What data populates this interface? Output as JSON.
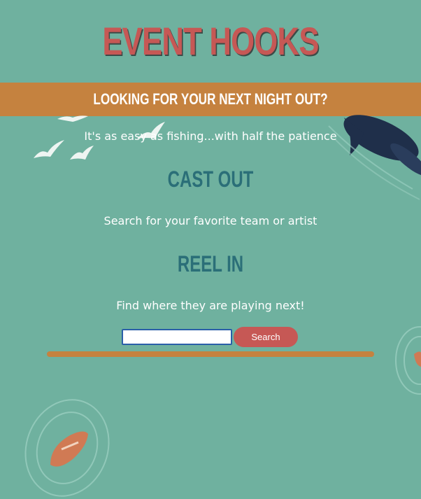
{
  "header": {
    "title": "EVENT HOOKS"
  },
  "banner": {
    "text": "LOOKING FOR YOUR NEXT NIGHT OUT?"
  },
  "intro": {
    "tagline": "It's as easy as fishing...with half the patience"
  },
  "steps": [
    {
      "heading": "CAST OUT",
      "text": "Search for your favorite team or artist"
    },
    {
      "heading": "REEL IN",
      "text": "Find where they are playing next!"
    }
  ],
  "search": {
    "input_value": "",
    "placeholder": "",
    "button_label": "Search"
  },
  "colors": {
    "background": "#6fb19f",
    "title": "#c65855",
    "banner": "#c5823f",
    "section_heading": "#2b6f78",
    "button": "#c65855",
    "divider": "#c5823f"
  },
  "icons": [
    "seagull-icon",
    "whale-icon",
    "boat-icon",
    "ripple-icon"
  ]
}
